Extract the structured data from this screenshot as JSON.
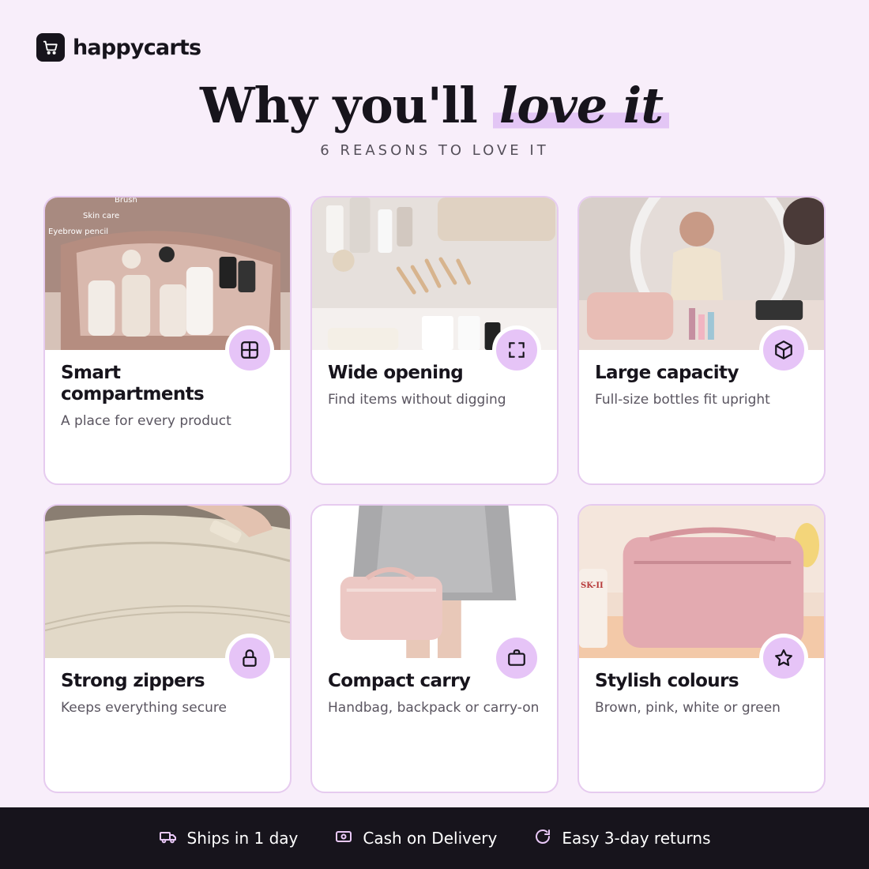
{
  "brand": {
    "name": "happycarts",
    "logo_icon": "cart-icon"
  },
  "headline": {
    "text": "Why you'll",
    "accent": "love it"
  },
  "subhead": "6 REASONS TO LOVE IT",
  "colors": {
    "background": "#f8eefa",
    "accent": "#e3c6f5",
    "badge": "#e6c4f7",
    "footer": "#17141c"
  },
  "features": [
    {
      "title": "Smart compartments",
      "desc": "A place for every product",
      "icon": "grid-icon",
      "photo_labels": [
        "Brush",
        "Skin care",
        "Eyebrow pencil"
      ]
    },
    {
      "title": "Wide opening",
      "desc": "Find items without digging",
      "icon": "expand-icon"
    },
    {
      "title": "Large capacity",
      "desc": "Full-size bottles fit upright",
      "icon": "box-icon"
    },
    {
      "title": "Strong zippers",
      "desc": "Keeps everything secure",
      "icon": "lock-icon"
    },
    {
      "title": "Compact carry",
      "desc": "Handbag, backpack or carry-on",
      "icon": "briefcase-icon"
    },
    {
      "title": "Stylish colours",
      "desc": "Brown, pink, white or green",
      "icon": "star-icon",
      "photo_labels": [
        "SK-II"
      ]
    }
  ],
  "footer": {
    "items": [
      {
        "label": "Ships in 1 day",
        "icon": "truck-icon"
      },
      {
        "label": "Cash on Delivery",
        "icon": "cash-icon"
      },
      {
        "label": "Easy 3-day returns",
        "icon": "refresh-icon"
      }
    ]
  }
}
